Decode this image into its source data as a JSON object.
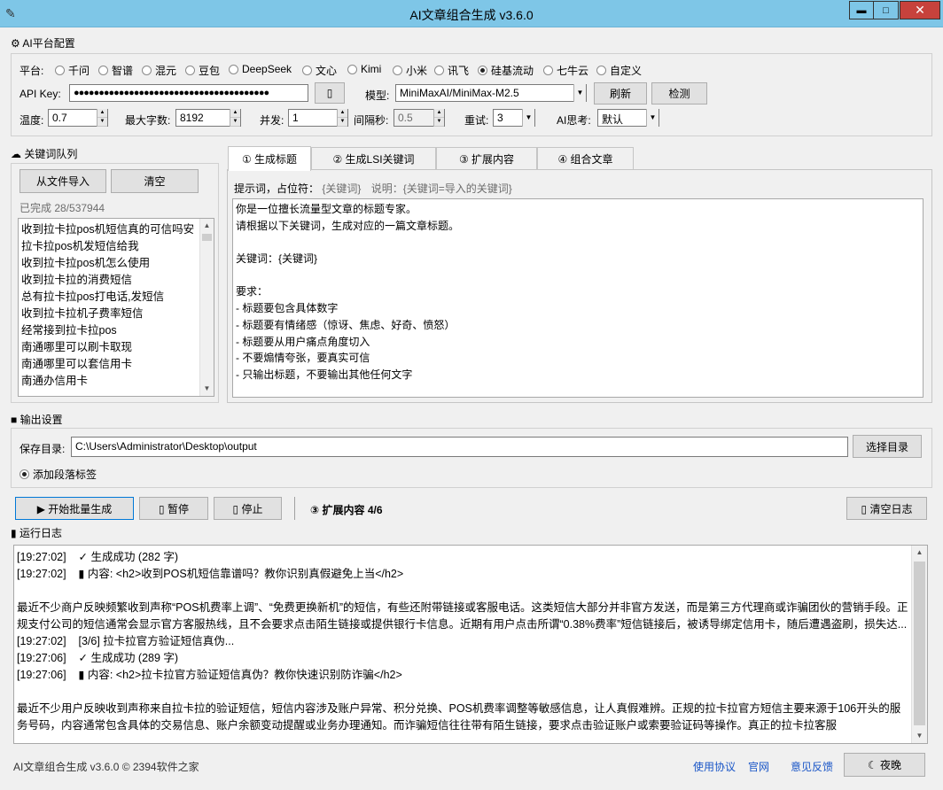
{
  "window": {
    "title": "AI文章组合生成 v3.6.0",
    "min_label": "▬",
    "max_label": "□",
    "close_label": "✕"
  },
  "platform_section": {
    "title": "⚙ AI平台配置",
    "platform_label": "平台:",
    "platforms": [
      "千问",
      "智谱",
      "混元",
      "豆包",
      "DeepSeek",
      "文心",
      "Kimi",
      "小米",
      "讯飞",
      "硅基流动",
      "七牛云",
      "自定义"
    ],
    "selected_platform": "硅基流动",
    "api_key_label": "API Key:",
    "api_key_value": "●●●●●●●●●●●●●●●●●●●●●●●●●●●●●●●●●●●●●●●",
    "eye_button": "▯",
    "model_label": "模型:",
    "model_value": "MiniMaxAI/MiniMax-M2.5",
    "refresh_button": "刷新",
    "check_button": "检测",
    "temp_label": "温度:",
    "temp_value": "0.7",
    "max_chars_label": "最大字数:",
    "max_chars_value": "8192",
    "concurrency_label": "并发:",
    "concurrency_value": "1",
    "interval_label": "间隔秒:",
    "interval_value": "0.5",
    "retry_label": "重试:",
    "retry_value": "3",
    "think_label": "AI思考:",
    "think_value": "默认"
  },
  "keyword_queue": {
    "title": "☁ 关键词队列",
    "import_button": "从文件导入",
    "clear_button": "清空",
    "progress": "已完成 28/537944",
    "items": [
      "收到拉卡拉pos机短信真的可信吗安",
      "拉卡拉pos机发短信给我",
      "收到拉卡拉pos机怎么使用",
      "收到拉卡拉的消费短信",
      "总有拉卡拉pos打电话,发短信",
      "收到拉卡拉机子费率短信",
      "经常接到拉卡拉pos",
      "南通哪里可以刷卡取现",
      "南通哪里可以套信用卡",
      "南通办信用卡"
    ]
  },
  "tabs": {
    "items": [
      "① 生成标题",
      "② 生成LSI关键词",
      "③ 扩展内容",
      "④ 组合文章"
    ],
    "active": 0,
    "hint_label": "提示词，占位符：",
    "hint_placeholder": "{关键词}",
    "hint_desc": "说明：{关键词=导入的关键词}",
    "prompt_lines": [
      "你是一位擅长流量型文章的标题专家。",
      "请根据以下关键词，生成对应的一篇文章标题。",
      "",
      "关键词：{关键词}",
      "",
      "要求：",
      "- 标题要包含具体数字",
      "- 标题要有情绪感（惊讶、焦虑、好奇、愤怒）",
      "- 标题要从用户痛点角度切入",
      "- 不要煽情夸张，要真实可信",
      "- 只输出标题，不要输出其他任何文字"
    ]
  },
  "output": {
    "title": "■ 输出设置",
    "save_dir_label": "保存目录:",
    "save_dir_value": "C:\\Users\\Administrator\\Desktop\\output",
    "choose_dir_button": "选择目录",
    "add_tag_label": "添加段落标签"
  },
  "actions": {
    "start_button": "▶ 开始批量生成",
    "pause_button": "▯ 暂停",
    "stop_button": "▯ 停止",
    "status": "③ 扩展内容 4/6",
    "clear_log_button": "▯ 清空日志"
  },
  "log": {
    "title": "▮ 运行日志",
    "lines": [
      {
        "kind": "line",
        "text": "[19:27:02]    ✓ 生成成功 (282 字)"
      },
      {
        "kind": "line",
        "text": "[19:27:02]    ▮ 内容: <h2>收到POS机短信靠谱吗？教你识别真假避免上当</h2>"
      },
      {
        "kind": "line",
        "text": ""
      },
      {
        "kind": "para",
        "text": "最近不少商户反映频繁收到声称“POS机费率上调”、“免费更换新机”的短信，有些还附带链接或客服电话。这类短信大部分并非官方发送，而是第三方代理商或诈骗团伙的营销手段。正规支付公司的短信通常会显示官方客服热线，且不会要求点击陌生链接或提供银行卡信息。近期有用户点击所谓“0.38%费率”短信链接后，被诱导绑定信用卡，随后遭遇盗刷，损失达..."
      },
      {
        "kind": "line",
        "text": "[19:27:02]    [3/6] 拉卡拉官方验证短信真伪..."
      },
      {
        "kind": "line",
        "text": "[19:27:06]    ✓ 生成成功 (289 字)"
      },
      {
        "kind": "line",
        "text": "[19:27:06]    ▮ 内容: <h2>拉卡拉官方验证短信真伪？教你快速识别防诈骗</h2>"
      },
      {
        "kind": "line",
        "text": ""
      },
      {
        "kind": "para",
        "text": "最近不少用户反映收到声称来自拉卡拉的验证短信，短信内容涉及账户异常、积分兑换、POS机费率调整等敏感信息，让人真假难辨。正规的拉卡拉官方短信主要来源于106开头的服务号码，内容通常包含具体的交易信息、账户余额变动提醒或业务办理通知。而诈骗短信往往带有陌生链接，要求点击验证账户或索要验证码等操作。真正的拉卡拉客服"
      }
    ]
  },
  "footer": {
    "copyright": "AI文章组合生成 v3.6.0  ©  2394软件之家",
    "links": [
      "使用协议",
      "官网",
      "意见反馈"
    ],
    "night_button": "☾ 夜晚"
  }
}
